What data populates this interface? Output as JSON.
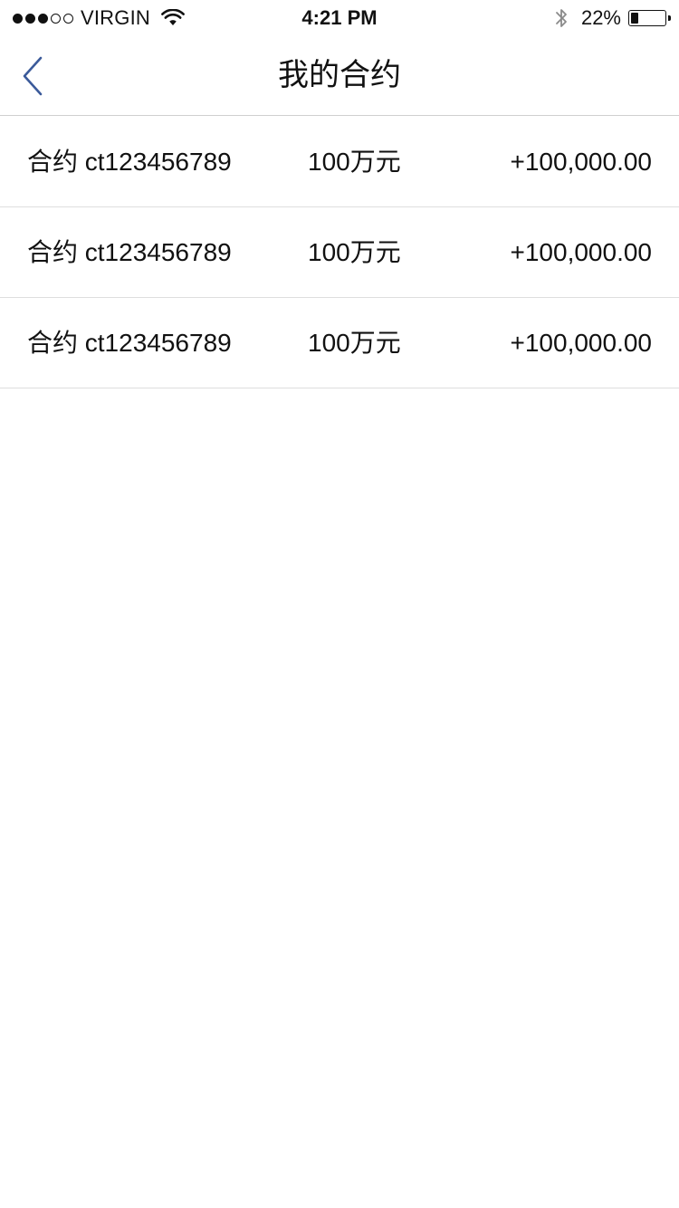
{
  "status_bar": {
    "signal_filled": 3,
    "signal_total": 5,
    "carrier": "VIRGIN",
    "time": "4:21 PM",
    "battery_percent_text": "22%",
    "battery_level": 0.22
  },
  "nav": {
    "title": "我的合约",
    "back_icon": "chevron-left-icon",
    "accent_color": "#3b5a9a"
  },
  "contracts": [
    {
      "name": "合约 ct123456789",
      "amount": "100万元",
      "value": "+100,000.00"
    },
    {
      "name": "合约 ct123456789",
      "amount": "100万元",
      "value": "+100,000.00"
    },
    {
      "name": "合约 ct123456789",
      "amount": "100万元",
      "value": "+100,000.00"
    }
  ]
}
